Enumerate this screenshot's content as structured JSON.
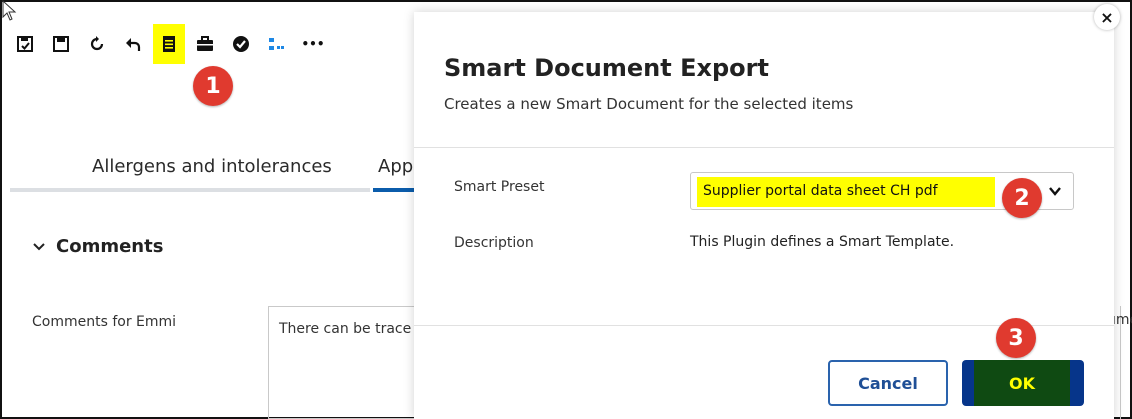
{
  "toolbar": {
    "icons": [
      "save-check-icon",
      "save-icon",
      "refresh-icon",
      "undo-icon",
      "smart-document-icon",
      "briefcase-icon",
      "check-circle-icon",
      "workflow-icon",
      "more-icon"
    ],
    "more_label": "•••"
  },
  "markers": {
    "m1": "1",
    "m2": "2",
    "m3": "3"
  },
  "tabs": [
    {
      "label": "Allergens and intolerances"
    },
    {
      "label": "App"
    }
  ],
  "comments": {
    "section_title": "Comments",
    "field_label": "Comments for Emmi",
    "field_value": "There can be trace",
    "right_fragment": "ıme"
  },
  "dialog": {
    "title": "Smart Document Export",
    "subtitle": "Creates a new Smart Document for the selected items",
    "preset_label": "Smart Preset",
    "preset_value": "Supplier portal data sheet CH pdf",
    "description_label": "Description",
    "description_value": "This Plugin defines a Smart Template.",
    "cancel_label": "Cancel",
    "ok_label": "OK",
    "close_label": "×"
  },
  "colors": {
    "highlight": "#ffff00",
    "marker_red": "#e03a2f",
    "primary_blue": "#06358a",
    "ok_overlay_green": "#0f4a12",
    "tab_active_blue": "#0b5cab"
  }
}
